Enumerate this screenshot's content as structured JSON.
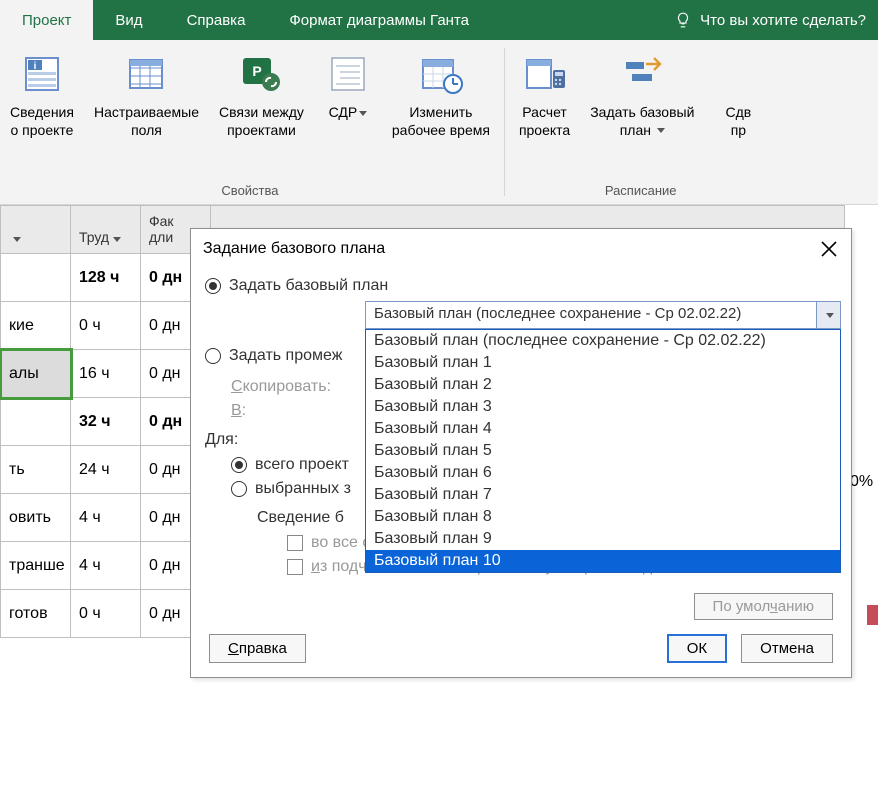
{
  "ribbon": {
    "tabs": [
      "Проект",
      "Вид",
      "Справка",
      "Формат диаграммы Ганта"
    ],
    "active": 0,
    "search": "Что вы хотите сделать?",
    "groups": [
      {
        "label": "Свойства",
        "buttons": [
          {
            "line1": "Сведения",
            "line2": "о проекте"
          },
          {
            "line1": "Настраиваемые",
            "line2": "поля"
          },
          {
            "line1": "Связи между",
            "line2": "проектами"
          },
          {
            "line1": "СДР",
            "line2": "",
            "dd": true
          },
          {
            "line1": "Изменить",
            "line2": "рабочее время"
          }
        ]
      },
      {
        "label": "Расписание",
        "buttons": [
          {
            "line1": "Расчет",
            "line2": "проекта"
          },
          {
            "line1": "Задать базовый",
            "line2": "план",
            "dd": true
          },
          {
            "line1": "Сдв",
            "line2": "пр"
          }
        ]
      }
    ]
  },
  "grid": {
    "headers": {
      "c0": "",
      "c1": "Труд",
      "c2a": "Фак",
      "c2b": "дли"
    },
    "rows": [
      {
        "c0": "",
        "c1": "128 ч",
        "c2": "0 дн",
        "bold": true
      },
      {
        "c0": "кие",
        "c1": "0 ч",
        "c2": "0 дн"
      },
      {
        "c0": "алы",
        "c1": "16 ч",
        "c2": "0 дн",
        "sel": true
      },
      {
        "c0": "",
        "c1": "32 ч",
        "c2": "0 дн",
        "bold": true
      },
      {
        "c0": "ть",
        "c1": "24 ч",
        "c2": "0 дн"
      },
      {
        "c0": "овить",
        "c1": "4 ч",
        "c2": "0 дн"
      },
      {
        "c0": "транше",
        "c1": "4 ч",
        "c2": "0 дн"
      },
      {
        "c0": "готов",
        "c1": "0 ч",
        "c2": "0 дн"
      }
    ],
    "right_val": "0%"
  },
  "dialog": {
    "title": "Задание базового плана",
    "opt_baseline": "Задать базовый план",
    "opt_interim": "Задать промеж",
    "copy_label": "Скопировать:",
    "into_label": "В:",
    "for_label": "Для:",
    "for_all": "всего проект",
    "for_sel": "выбранных з",
    "rollup_label": "Сведение б",
    "cb_all": "во все с",
    "cb_sub": "из подчиненных в выбранные суммарные задачи",
    "default_btn": "По умолчанию",
    "help": "Справка",
    "ok": "ОК",
    "cancel": "Отмена",
    "combo": {
      "selected": "Базовый план (последнее сохранение - Ср 02.02.22)",
      "items": [
        "Базовый план (последнее сохранение - Ср 02.02.22)",
        "Базовый план 1",
        "Базовый план 2",
        "Базовый план 3",
        "Базовый план 4",
        "Базовый план 5",
        "Базовый план 6",
        "Базовый план 7",
        "Базовый план 8",
        "Базовый план 9",
        "Базовый план 10"
      ],
      "highlight": 10
    }
  }
}
